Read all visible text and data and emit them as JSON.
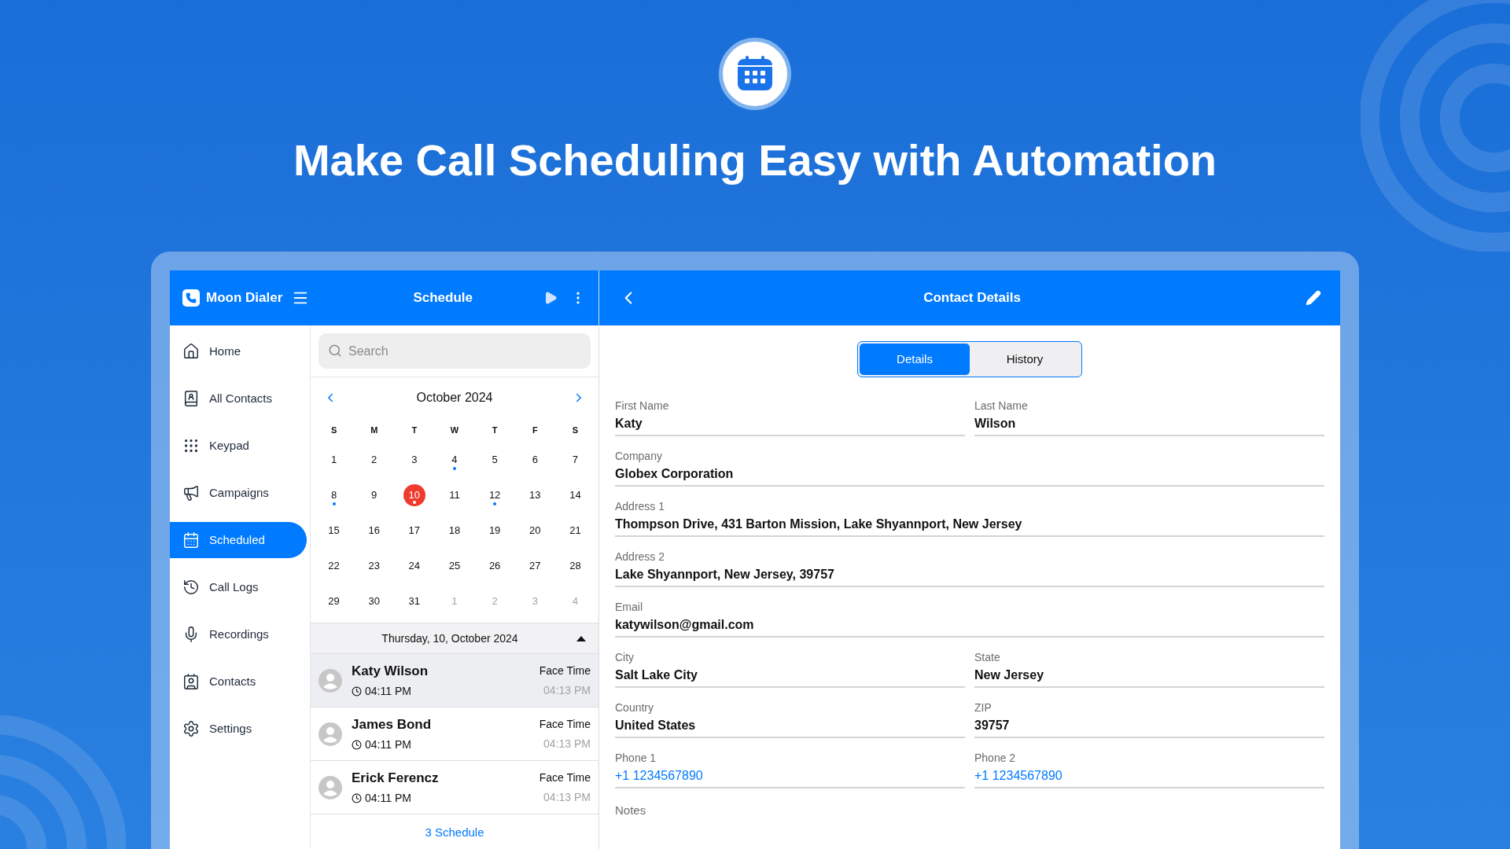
{
  "headline": "Make Call Scheduling Easy with Automation",
  "app": {
    "name": "Moon Dialer"
  },
  "sidebar": {
    "items": [
      {
        "label": "Home",
        "kind": "home",
        "selected": false
      },
      {
        "label": "All Contacts",
        "kind": "book",
        "selected": false
      },
      {
        "label": "Keypad",
        "kind": "keypad",
        "selected": false
      },
      {
        "label": "Campaigns",
        "kind": "megaphone",
        "selected": false
      },
      {
        "label": "Scheduled",
        "kind": "calendar",
        "selected": true
      },
      {
        "label": "Call Logs",
        "kind": "history",
        "selected": false
      },
      {
        "label": "Recordings",
        "kind": "mic",
        "selected": false
      },
      {
        "label": "Contacts",
        "kind": "contact",
        "selected": false
      },
      {
        "label": "Settings",
        "kind": "settings",
        "selected": false
      }
    ]
  },
  "schedule": {
    "title": "Schedule",
    "search": {
      "placeholder": "Search"
    },
    "calendar": {
      "month": "October 2024",
      "weekdays": [
        "S",
        "M",
        "T",
        "W",
        "T",
        "F",
        "S"
      ],
      "weeks": [
        [
          {
            "label": "1",
            "has_event": false,
            "selected": false,
            "outside": false
          },
          {
            "label": "2",
            "has_event": false,
            "selected": false,
            "outside": false
          },
          {
            "label": "3",
            "has_event": false,
            "selected": false,
            "outside": false
          },
          {
            "label": "4",
            "has_event": true,
            "selected": false,
            "outside": false
          },
          {
            "label": "5",
            "has_event": false,
            "selected": false,
            "outside": false
          },
          {
            "label": "6",
            "has_event": false,
            "selected": false,
            "outside": false
          },
          {
            "label": "7",
            "has_event": false,
            "selected": false,
            "outside": false
          }
        ],
        [
          {
            "label": "8",
            "has_event": true,
            "selected": false,
            "outside": false
          },
          {
            "label": "9",
            "has_event": false,
            "selected": false,
            "outside": false
          },
          {
            "label": "10",
            "has_event": true,
            "selected": true,
            "outside": false
          },
          {
            "label": "11",
            "has_event": false,
            "selected": false,
            "outside": false
          },
          {
            "label": "12",
            "has_event": true,
            "selected": false,
            "outside": false
          },
          {
            "label": "13",
            "has_event": false,
            "selected": false,
            "outside": false
          },
          {
            "label": "14",
            "has_event": false,
            "selected": false,
            "outside": false
          }
        ],
        [
          {
            "label": "15",
            "has_event": false,
            "selected": false,
            "outside": false
          },
          {
            "label": "16",
            "has_event": false,
            "selected": false,
            "outside": false
          },
          {
            "label": "17",
            "has_event": false,
            "selected": false,
            "outside": false
          },
          {
            "label": "18",
            "has_event": false,
            "selected": false,
            "outside": false
          },
          {
            "label": "19",
            "has_event": false,
            "selected": false,
            "outside": false
          },
          {
            "label": "20",
            "has_event": false,
            "selected": false,
            "outside": false
          },
          {
            "label": "21",
            "has_event": false,
            "selected": false,
            "outside": false
          }
        ],
        [
          {
            "label": "22",
            "has_event": false,
            "selected": false,
            "outside": false
          },
          {
            "label": "23",
            "has_event": false,
            "selected": false,
            "outside": false
          },
          {
            "label": "24",
            "has_event": false,
            "selected": false,
            "outside": false
          },
          {
            "label": "25",
            "has_event": false,
            "selected": false,
            "outside": false
          },
          {
            "label": "26",
            "has_event": false,
            "selected": false,
            "outside": false
          },
          {
            "label": "27",
            "has_event": false,
            "selected": false,
            "outside": false
          },
          {
            "label": "28",
            "has_event": false,
            "selected": false,
            "outside": false
          }
        ],
        [
          {
            "label": "29",
            "has_event": false,
            "selected": false,
            "outside": false
          },
          {
            "label": "30",
            "has_event": false,
            "selected": false,
            "outside": false
          },
          {
            "label": "31",
            "has_event": false,
            "selected": false,
            "outside": false
          },
          {
            "label": "1",
            "has_event": false,
            "selected": false,
            "outside": true
          },
          {
            "label": "2",
            "has_event": false,
            "selected": false,
            "outside": true
          },
          {
            "label": "3",
            "has_event": false,
            "selected": false,
            "outside": true
          },
          {
            "label": "4",
            "has_event": false,
            "selected": false,
            "outside": true
          }
        ]
      ]
    },
    "day_header": {
      "label": "Thursday, 10, October 2024",
      "expanded": true
    },
    "items": [
      {
        "name": "Katy Wilson",
        "time": "04:11 PM",
        "type": "Face Time",
        "end": "04:13 PM",
        "selected": true
      },
      {
        "name": "James Bond",
        "time": "04:11 PM",
        "type": "Face Time",
        "end": "04:13 PM",
        "selected": false
      },
      {
        "name": "Erick Ferencz",
        "time": "04:11 PM",
        "type": "Face Time",
        "end": "04:13 PM",
        "selected": false
      }
    ],
    "footer": "3 Schedule"
  },
  "contact": {
    "title": "Contact Details",
    "tabs": [
      {
        "label": "Details",
        "selected": true
      },
      {
        "label": "History",
        "selected": false
      }
    ],
    "rows": [
      {
        "fields": [
          {
            "label": "First Name",
            "value": "Katy",
            "kind": "text"
          },
          {
            "label": "Last Name",
            "value": "Wilson",
            "kind": "text"
          }
        ]
      },
      {
        "fields": [
          {
            "label": "Company",
            "value": "Globex Corporation",
            "kind": "text"
          }
        ]
      },
      {
        "fields": [
          {
            "label": "Address 1",
            "value": "Thompson Drive, 431 Barton Mission, Lake Shyannport, New Jersey",
            "kind": "text"
          }
        ]
      },
      {
        "fields": [
          {
            "label": "Address 2",
            "value": "Lake Shyannport, New Jersey, 39757",
            "kind": "text"
          }
        ]
      },
      {
        "fields": [
          {
            "label": "Email",
            "value": "katywilson@gmail.com",
            "kind": "text"
          }
        ]
      },
      {
        "fields": [
          {
            "label": "City",
            "value": "Salt Lake City",
            "kind": "text"
          },
          {
            "label": "State",
            "value": "New Jersey",
            "kind": "text"
          }
        ]
      },
      {
        "fields": [
          {
            "label": "Country",
            "value": "United States",
            "kind": "text"
          },
          {
            "label": "ZIP",
            "value": "39757",
            "kind": "text"
          }
        ]
      },
      {
        "fields": [
          {
            "label": "Phone 1",
            "value": "+1 1234567890",
            "kind": "phone"
          },
          {
            "label": "Phone 2",
            "value": "+1 1234567890",
            "kind": "phone"
          }
        ]
      }
    ],
    "notes_label": "Notes"
  }
}
